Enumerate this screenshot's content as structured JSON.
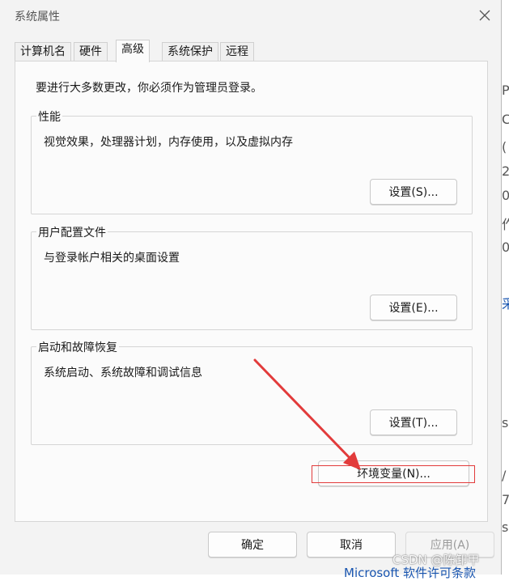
{
  "window": {
    "title": "系统属性"
  },
  "tabs": [
    {
      "label": "计算机名"
    },
    {
      "label": "硬件"
    },
    {
      "label": "高级"
    },
    {
      "label": "系统保护"
    },
    {
      "label": "远程"
    }
  ],
  "active_tab": "高级",
  "admin_note": "要进行大多数更改，你必须作为管理员登录。",
  "groups": [
    {
      "title": "性能",
      "description": "视觉效果，处理器计划，内存使用，以及虚拟内存",
      "button": "设置(S)..."
    },
    {
      "title": "用户配置文件",
      "description": "与登录帐户相关的桌面设置",
      "button": "设置(E)..."
    },
    {
      "title": "启动和故障恢复",
      "description": "系统启动、系统故障和调试信息",
      "button": "设置(T)..."
    }
  ],
  "env_button": "环境变量(N)...",
  "footer": {
    "ok": "确定",
    "cancel": "取消",
    "apply": "应用(A)"
  },
  "background": {
    "sliver_chars": [
      "P",
      "C",
      "(",
      "2",
      "0",
      "作",
      "0",
      "采",
      "s",
      "/",
      "7",
      "s"
    ],
    "link_text": "Microsoft 软件许可条款"
  },
  "watermark": "CSDN @陈卸甲",
  "annotation": {
    "arrow_color": "#e23b3b",
    "box_color": "#e23b3b"
  }
}
